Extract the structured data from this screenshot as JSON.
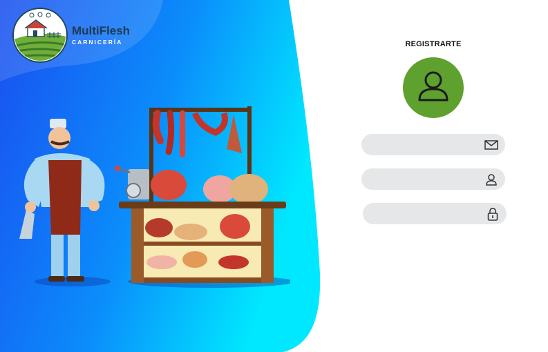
{
  "brand": {
    "name": "MultiFlesh",
    "subtitle": "CARNICERÍA"
  },
  "form": {
    "title": "REGISTRARTE",
    "avatar_icon": "user-avatar-icon",
    "fields": [
      {
        "icon": "envelope-icon",
        "value": "",
        "placeholder": ""
      },
      {
        "icon": "user-icon",
        "value": "",
        "placeholder": ""
      },
      {
        "icon": "lock-icon",
        "value": "",
        "placeholder": ""
      }
    ]
  },
  "colors": {
    "gradient_start": "#1a4ff0",
    "gradient_end": "#00e8ff",
    "avatar_bg": "#5ea12e",
    "field_bg": "#e6e7e9"
  }
}
